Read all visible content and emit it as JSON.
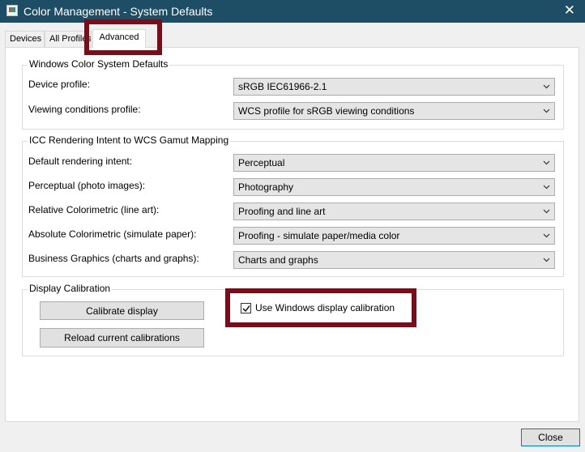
{
  "window": {
    "title": "Color Management - System Defaults",
    "app_icon": "color-management-icon",
    "close_glyph": "✕"
  },
  "tabs": [
    {
      "label": "Devices"
    },
    {
      "label": "All Profiles"
    },
    {
      "label": "Advanced"
    }
  ],
  "wcs_defaults": {
    "title": "Windows Color System Defaults",
    "rows": [
      {
        "label": "Device profile:",
        "value": "sRGB IEC61966-2.1"
      },
      {
        "label": "Viewing conditions profile:",
        "value": "WCS profile for sRGB viewing conditions"
      }
    ]
  },
  "icc_mapping": {
    "title": "ICC Rendering Intent to WCS Gamut Mapping",
    "rows": [
      {
        "label": "Default rendering intent:",
        "value": "Perceptual"
      },
      {
        "label": "Perceptual (photo images):",
        "value": "Photography"
      },
      {
        "label": "Relative Colorimetric (line art):",
        "value": "Proofing and line art"
      },
      {
        "label": "Absolute Colorimetric (simulate paper):",
        "value": "Proofing - simulate paper/media color"
      },
      {
        "label": "Business Graphics (charts and graphs):",
        "value": "Charts and graphs"
      }
    ]
  },
  "display_calibration": {
    "title": "Display Calibration",
    "calibrate_button": "Calibrate display",
    "reload_button": "Reload current calibrations",
    "use_windows_calibration_label": "Use Windows display calibration",
    "use_windows_calibration_checked": true
  },
  "footer": {
    "close_button": "Close"
  },
  "colors": {
    "titlebar": "#1e4e66",
    "highlight": "#7a0d1a",
    "combo_bg": "#e5e5e5",
    "button_bg": "#e1e1e1"
  }
}
